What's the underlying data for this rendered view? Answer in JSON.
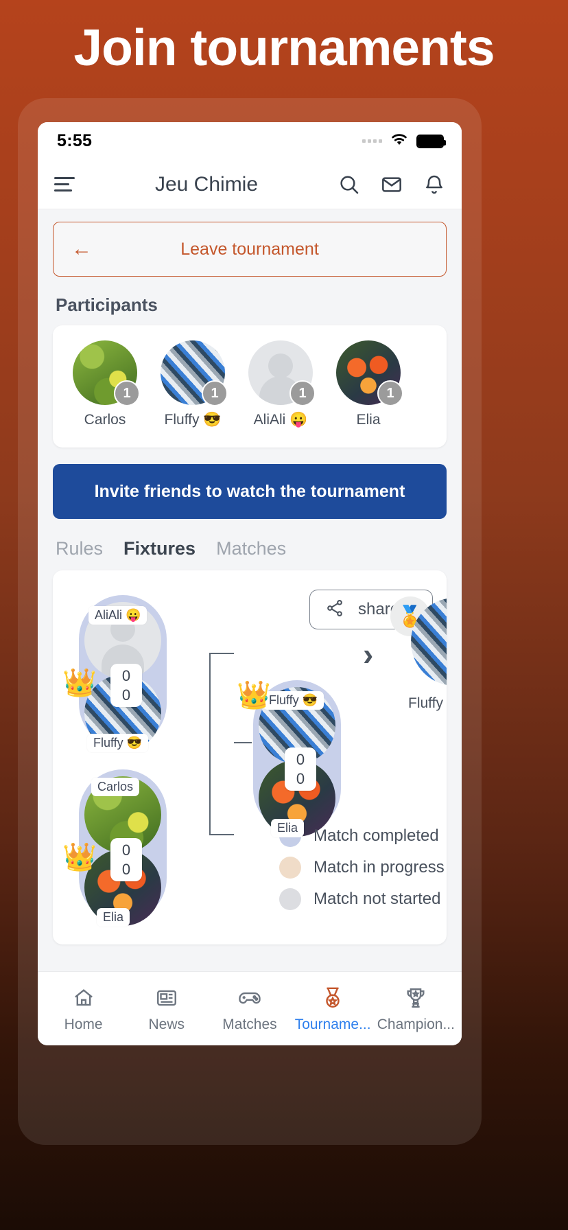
{
  "promo": {
    "headline": "Join tournaments"
  },
  "status_bar": {
    "time": "5:55",
    "wifi_icon": "wifi-icon",
    "battery_icon": "battery-icon",
    "signal_icon": "signal-dots-icon"
  },
  "app_bar": {
    "title": "Jeu Chimie",
    "menu_icon": "hamburger-menu-icon",
    "search_icon": "search-icon",
    "mail_icon": "mail-icon",
    "bell_icon": "bell-icon"
  },
  "leave_tournament": {
    "label": "Leave tournament",
    "arrow_icon": "arrow-left-icon",
    "accent": "#c4572c"
  },
  "participants": {
    "heading": "Participants",
    "items": [
      {
        "name": "Carlos",
        "badge": "1",
        "avatar": "leaves-photo"
      },
      {
        "name": "Fluffy 😎",
        "badge": "1",
        "avatar": "collage-photo"
      },
      {
        "name": "AliAli 😛",
        "badge": "1",
        "avatar": "default-person-silhouette"
      },
      {
        "name": "Elia",
        "badge": "1",
        "avatar": "flowers-photo"
      }
    ]
  },
  "invite": {
    "label": "Invite friends to watch the tournament",
    "color": "#1e4b9b"
  },
  "tabs": [
    {
      "label": "Rules",
      "active": false
    },
    {
      "label": "Fixtures",
      "active": true
    },
    {
      "label": "Matches",
      "active": false
    }
  ],
  "bracket": {
    "share": {
      "label": "share",
      "icon": "share-icon"
    },
    "matches": [
      {
        "id": "semi-1",
        "status": "completed",
        "top": {
          "name": "AliAli 😛",
          "score": "0",
          "winner": false,
          "avatar": "default-person-silhouette"
        },
        "bottom": {
          "name": "Fluffy 😎",
          "score": "0",
          "winner": true,
          "avatar": "collage-photo"
        }
      },
      {
        "id": "semi-2",
        "status": "completed",
        "top": {
          "name": "Carlos",
          "score": "0",
          "winner": false,
          "avatar": "leaves-photo"
        },
        "bottom": {
          "name": "Elia",
          "score": "0",
          "winner": true,
          "avatar": "flowers-photo"
        }
      },
      {
        "id": "final",
        "status": "completed",
        "top": {
          "name": "Fluffy 😎",
          "score": "0",
          "winner": true,
          "avatar": "collage-photo"
        },
        "bottom": {
          "name": "Elia",
          "score": "0",
          "winner": false,
          "avatar": "flowers-photo"
        }
      }
    ],
    "champion": {
      "name": "Fluffy 😎",
      "avatar": "collage-photo",
      "medal_icon": "medal-icon",
      "chevron_icon": "chevron-right-icon",
      "crown_icon": "crown-icon"
    },
    "legend": [
      {
        "label": "Match completed",
        "color": "#c5cee8"
      },
      {
        "label": "Match in progress",
        "color": "#f0dcc8"
      },
      {
        "label": "Match not started",
        "color": "#dcdde1"
      }
    ]
  },
  "bottom_nav": [
    {
      "label": "Home",
      "icon": "home-icon",
      "active": false
    },
    {
      "label": "News",
      "icon": "news-icon",
      "active": false
    },
    {
      "label": "Matches",
      "icon": "gamepad-icon",
      "active": false
    },
    {
      "label": "Tourname...",
      "icon": "medal-icon",
      "active": true
    },
    {
      "label": "Champion...",
      "icon": "trophy-icon",
      "active": false
    }
  ]
}
